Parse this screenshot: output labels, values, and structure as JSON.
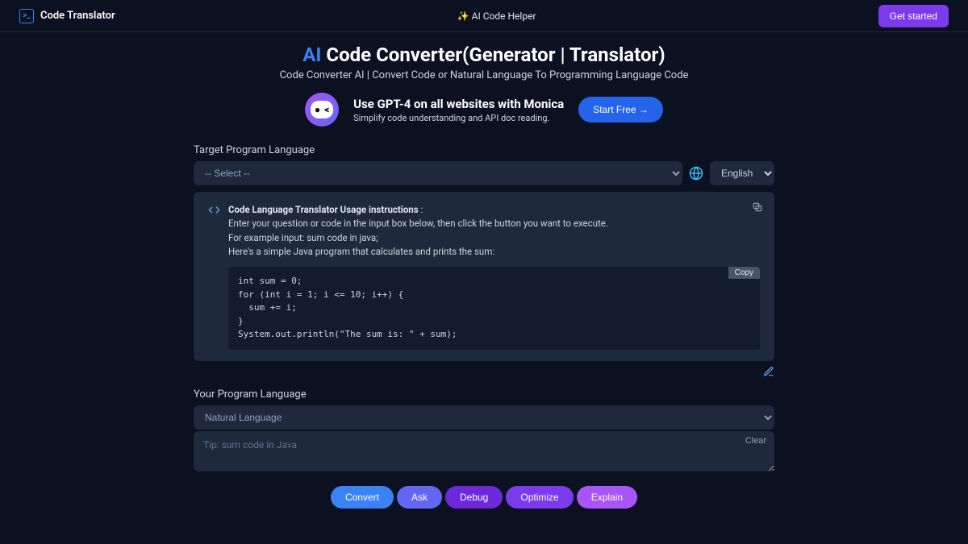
{
  "header": {
    "brand": "Code Translator",
    "helper": "✨ AI Code Helper",
    "cta": "Get started"
  },
  "hero": {
    "title_ai": "AI",
    "title_rest": " Code Converter(Generator | Translator)",
    "subtitle": "Code Converter AI | Convert Code or Natural Language To Programming Language Code"
  },
  "promo": {
    "title": "Use GPT-4 on all websites with Monica",
    "subtitle": "Simplify code understanding and API doc reading.",
    "button": "Start Free →"
  },
  "target": {
    "label": "Target Program Language",
    "select_placeholder": "-- Select --",
    "ui_language": "English"
  },
  "instructions": {
    "heading": "Code Language Translator Usage instructions",
    "colon": " :",
    "line1": "Enter your question or code in the input box below, then click the button you want to execute.",
    "line2": "For example input: sum code in java;",
    "line3": "Here's a simple Java program that calculates and prints the sum:",
    "copy_button": "Copy",
    "code": "int sum = 0;\nfor (int i = 1; i <= 10; i++) {\n  sum += i;\n}\nSystem.out.println(\"The sum is: \" + sum);"
  },
  "input": {
    "label": "Your Program Language",
    "selected": "Natural Language",
    "placeholder": "Tip: sum code in Java",
    "clear": "Clear"
  },
  "actions": {
    "convert": "Convert",
    "ask": "Ask",
    "debug": "Debug",
    "optimize": "Optimize",
    "explain": "Explain"
  }
}
